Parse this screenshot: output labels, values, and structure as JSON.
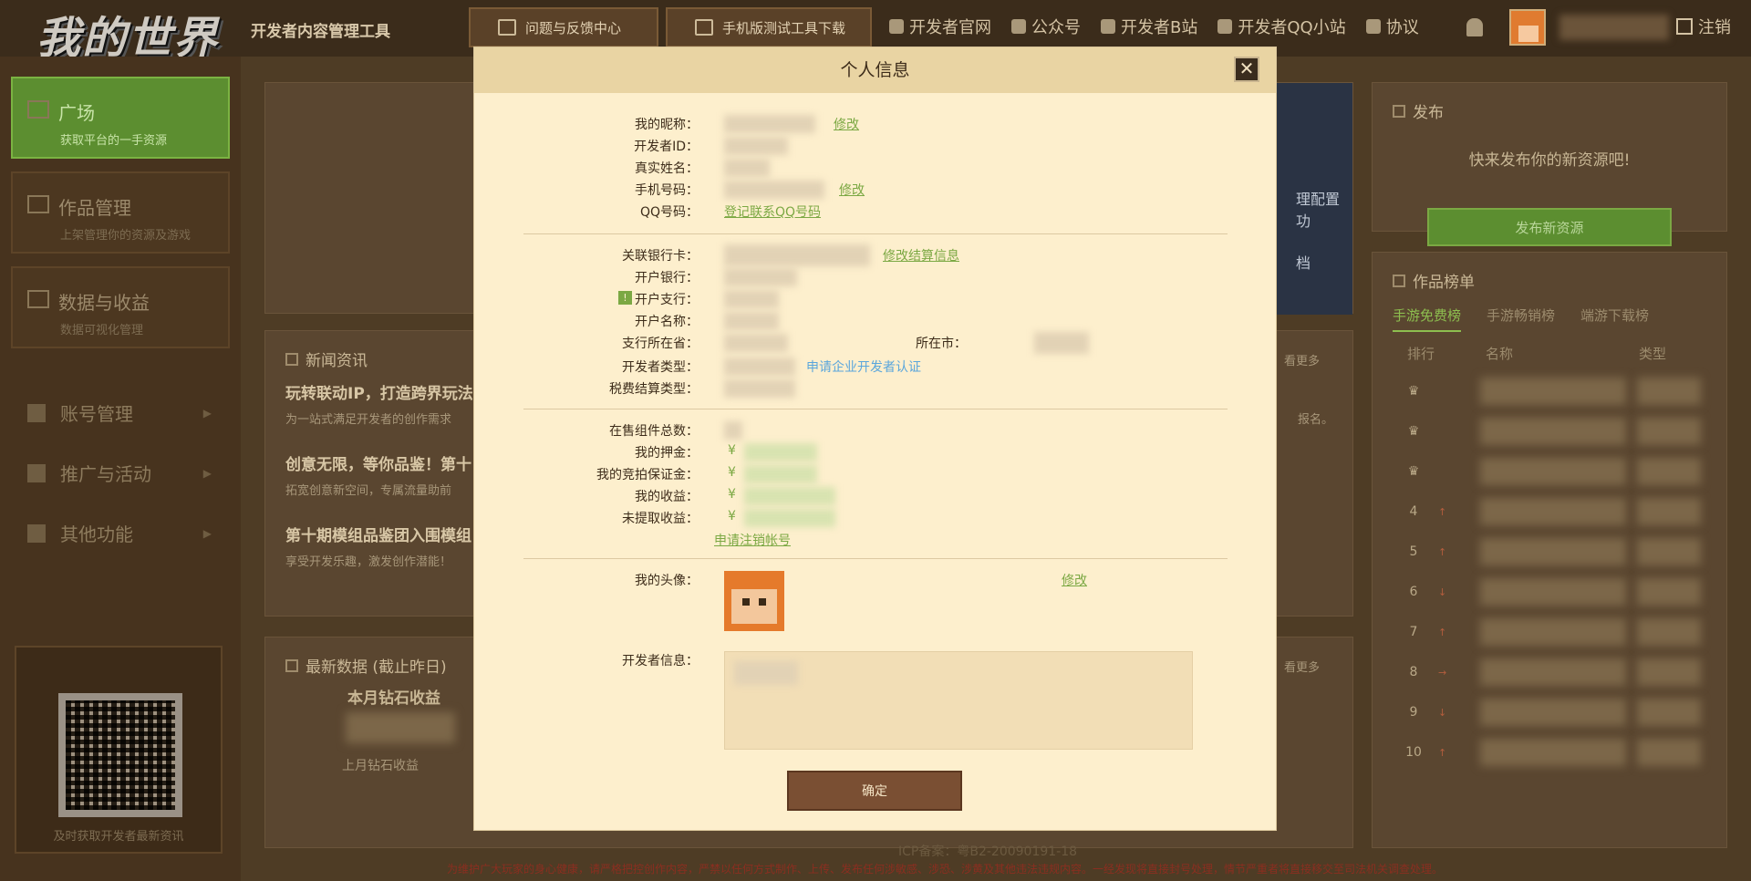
{
  "header": {
    "logo": "我的世界",
    "subtitle": "开发者内容管理工具",
    "btn_feedback": "问题与反馈中心",
    "btn_mobile": "手机版测试工具下载",
    "links": [
      "开发者官网",
      "公众号",
      "开发者B站",
      "开发者QQ小站",
      "协议"
    ],
    "logout": "注销"
  },
  "sidebar": {
    "plaza_title": "广场",
    "plaza_sub": "获取平台的一手资源",
    "works_title": "作品管理",
    "works_sub": "上架管理你的资源及游戏",
    "data_title": "数据与收益",
    "data_sub": "数据可视化管理",
    "menu_account": "账号管理",
    "menu_promo": "推广与活动",
    "menu_other": "其他功能",
    "qr_caption": "及时获取开发者最新资讯"
  },
  "main": {
    "publish_title": "发布",
    "publish_text": "快来发布你的新资源吧!",
    "publish_btn": "发布新资源",
    "news_title": "新闻资讯",
    "news_more": "看更多",
    "news": [
      {
        "title": "玩转联动IP，打造跨界玩法",
        "sub": "为一站式满足开发者的创作需求"
      },
      {
        "title": "创意无限，等你品鉴！第十",
        "sub": "拓宽创意新空间，专属流量助前"
      },
      {
        "title": "第十期模组品鉴团入围模组",
        "sub": "享受开发乐趣，激发创作潜能！"
      }
    ],
    "news_tail": "报名。",
    "data_title": "最新数据 (截止昨日)",
    "data_more": "看更多",
    "diamond_title": "本月钻石收益",
    "diamond_last": "上月钻石收益",
    "rank_title": "作品榜单",
    "rank_tabs": [
      "手游免费榜",
      "手游畅销榜",
      "端游下载榜"
    ],
    "rank_head": [
      "排行",
      "名称",
      "类型"
    ],
    "rank_numbers": [
      "4",
      "5",
      "6",
      "7",
      "8",
      "9",
      "10"
    ],
    "banner_text1": "理配置功",
    "banner_text2": "档"
  },
  "footer": {
    "icp": "ICP备案：粤B2-20090191-18",
    "notice": "为维护广大玩家的身心健康，请严格把控创作内容，严禁以任何方式制作、上传、发布任何涉敏感、涉恐、涉黄及其他违法违规内容。一经发现将直接封号处理，情节严重者将直接移交至司法机关调查处理。"
  },
  "modal": {
    "title": "个人信息",
    "close": "✕",
    "nickname": "我的昵称：",
    "dev_id": "开发者ID：",
    "real_name": "真实姓名：",
    "phone": "手机号码：",
    "qq": "QQ号码：",
    "qq_link": "登记联系QQ号码",
    "edit": "修改",
    "bank_card": "关联银行卡：",
    "bank_edit": "修改结算信息",
    "bank": "开户银行：",
    "branch": "开户支行：",
    "account_name": "开户名称：",
    "province": "支行所在省：",
    "city": "所在市：",
    "dev_type": "开发者类型：",
    "apply_enterprise": "申请企业开发者认证",
    "tax_type": "税费结算类型：",
    "components": "在售组件总数：",
    "deposit": "我的押金：",
    "auction_deposit": "我的竞拍保证金：",
    "income": "我的收益：",
    "unwithdrawn": "未提取收益：",
    "yen": "¥",
    "cancel_account": "申请注销帐号",
    "avatar": "我的头像：",
    "dev_info": "开发者信息：",
    "confirm": "确定",
    "tag": "!"
  },
  "colors": {
    "accent_green": "#7ba843",
    "link_blue": "#5aa6dc",
    "modal_bg": "#fdefcd",
    "modal_header": "#e9d4a3",
    "confirm_bg": "#7a4f33"
  }
}
